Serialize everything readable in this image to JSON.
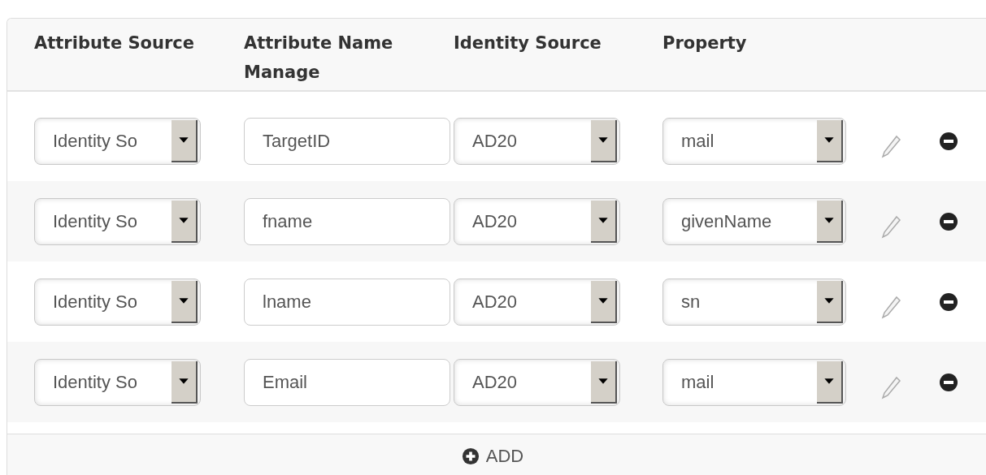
{
  "columns": [
    "Attribute Source",
    "Attribute Name Manage",
    "Identity Source",
    "Property"
  ],
  "rows": [
    {
      "source": "Identity So",
      "name": "TargetID",
      "identity": "AD20",
      "property": "mail"
    },
    {
      "source": "Identity So",
      "name": "fname",
      "identity": "AD20",
      "property": "givenName"
    },
    {
      "source": "Identity So",
      "name": "lname",
      "identity": "AD20",
      "property": "sn"
    },
    {
      "source": "Identity So",
      "name": "Email",
      "identity": "AD20",
      "property": "mail"
    }
  ],
  "add_button": {
    "label": "ADD"
  }
}
